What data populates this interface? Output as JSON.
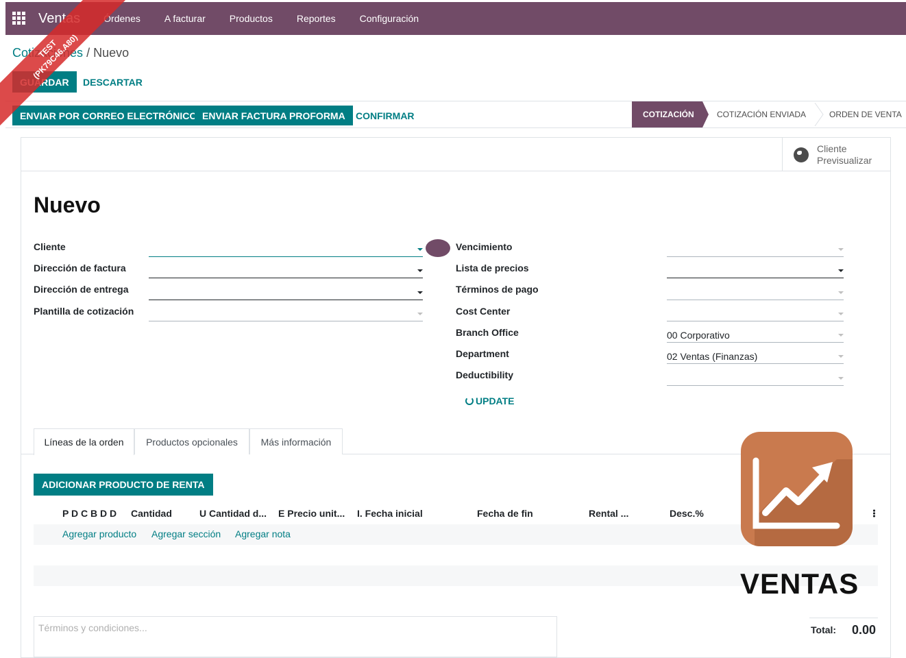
{
  "ribbon": {
    "line1": "TEST",
    "line2": "(PK79C46.A80)"
  },
  "navbar": {
    "brand": "Ventas",
    "items": [
      "Órdenes",
      "A facturar",
      "Productos",
      "Reportes",
      "Configuración"
    ]
  },
  "breadcrumb": {
    "parent": "Cotizaciones",
    "separator": " / ",
    "current": "Nuevo"
  },
  "control": {
    "save_label": "GUARDAR",
    "discard_label": "DESCARTAR"
  },
  "statusbar": {
    "buttons": [
      "ENVIAR POR CORREO ELECTRÓNICO",
      "ENVIAR FACTURA PROFORMA",
      "CONFIRMAR"
    ],
    "stages": [
      "COTIZACIÓN",
      "COTIZACIÓN ENVIADA",
      "ORDEN DE VENTA"
    ]
  },
  "stat_button": {
    "line1": "Cliente",
    "line2": "Previsualizar"
  },
  "record": {
    "title": "Nuevo"
  },
  "left_fields": [
    {
      "label": "Cliente",
      "value": ""
    },
    {
      "label": "Dirección de factura",
      "value": ""
    },
    {
      "label": "Dirección de entrega",
      "value": ""
    },
    {
      "label": "Plantilla de cotización",
      "value": ""
    }
  ],
  "right_fields": [
    {
      "label": "Vencimiento",
      "value": ""
    },
    {
      "label": "Lista de precios",
      "value": ""
    },
    {
      "label": "Términos de pago",
      "value": ""
    },
    {
      "label": "Cost Center",
      "value": ""
    },
    {
      "label": "Branch Office",
      "value": "00 Corporativo"
    },
    {
      "label": "Department",
      "value": "02 Ventas (Finanzas)"
    },
    {
      "label": "Deductibility",
      "value": ""
    }
  ],
  "update_label": "UPDATE",
  "tabs": [
    "Líneas de la orden",
    "Productos opcionales",
    "Más información"
  ],
  "add_rental_label": "ADICIONAR PRODUCTO DE RENTA",
  "line_columns": [
    "P D C B D D",
    "Cantidad",
    "U Cantidad d...",
    "E Precio unit...",
    "I. Fecha inicial",
    "Fecha de fin",
    "Rental ...",
    "Desc.%"
  ],
  "add_links": [
    "Agregar producto",
    "Agregar sección",
    "Agregar nota"
  ],
  "terms_placeholder": "Términos y condiciones...",
  "total": {
    "label": "Total:",
    "value": "0.00"
  },
  "app_logo": {
    "text": "VENTAS",
    "color": "#c97a4e"
  },
  "colors": {
    "primary": "#714b67",
    "accent": "#017e84"
  }
}
